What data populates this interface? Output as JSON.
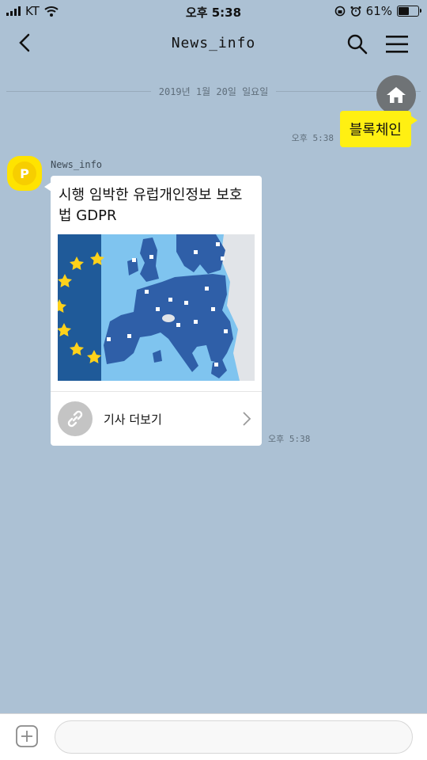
{
  "status": {
    "carrier": "KT",
    "time": "오후 5:38",
    "battery": "61%",
    "battery_level": 0.61
  },
  "header": {
    "title": "News_info",
    "icons": [
      "back-arrow-icon",
      "search-icon",
      "menu-icon"
    ]
  },
  "chat": {
    "date": "2019년 1월 20일 일요일",
    "my_message": {
      "text": "블록체인",
      "time": "오후 5:38"
    },
    "sender_name": "News_info",
    "avatar_letter": "P",
    "card": {
      "title": "시행 임박한 유럽개인정보 보호법 GDPR",
      "link_label": "기사 더보기",
      "time": "오후 5:38"
    }
  },
  "input": {
    "placeholder": ""
  },
  "colors": {
    "background": "#acc1d4",
    "bubble": "#fff012",
    "card_map_sea": "#7fc4ef",
    "card_map_land": "#2f5fa8"
  }
}
